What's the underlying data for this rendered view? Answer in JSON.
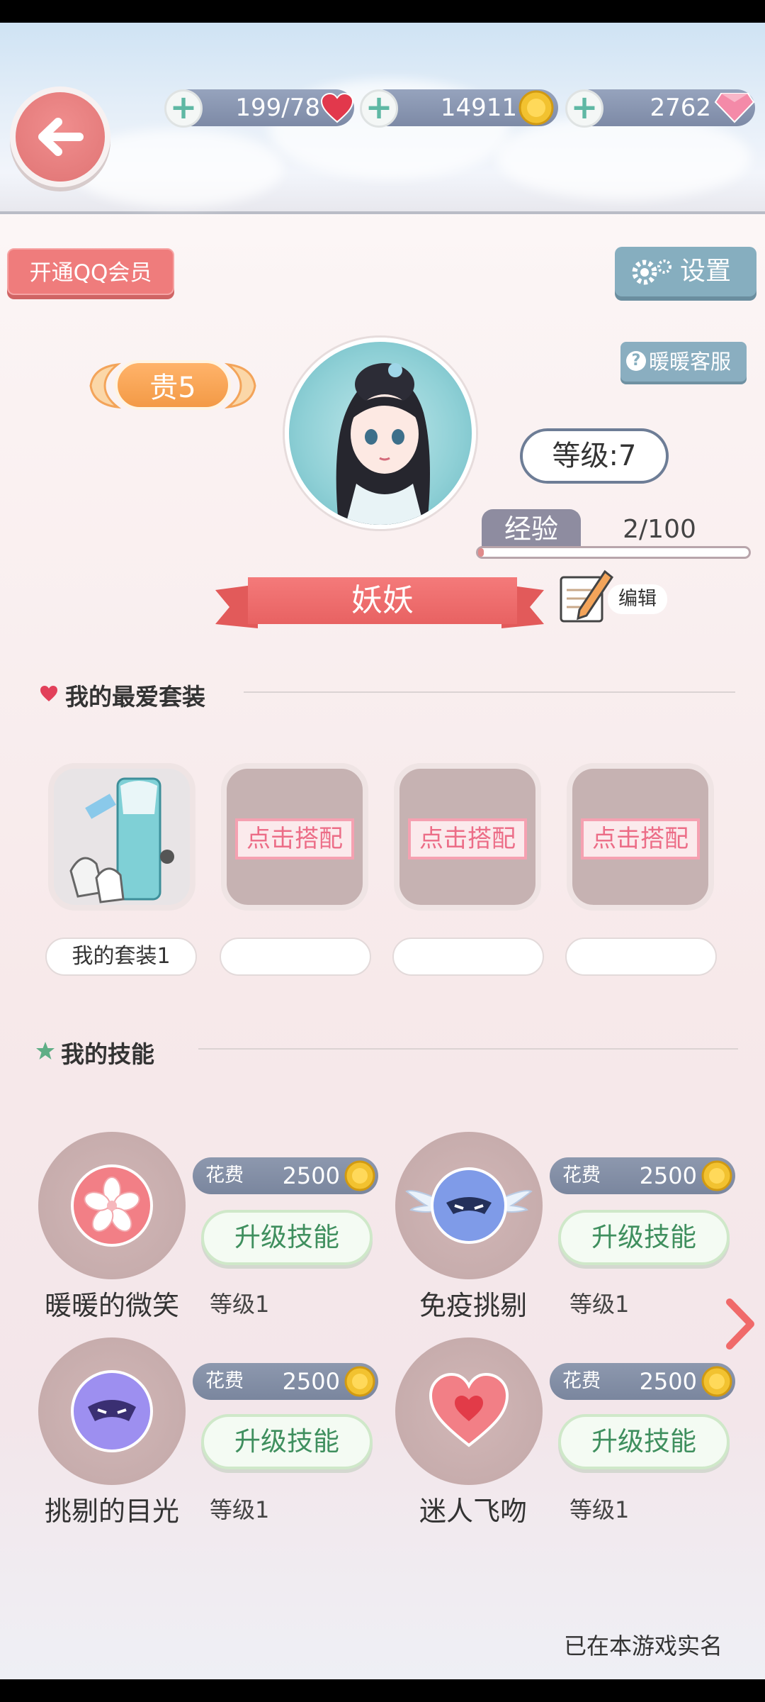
{
  "resources": {
    "stamina": "199/78",
    "gold": "14911",
    "diamonds": "2762"
  },
  "buttons": {
    "qq_vip": "开通QQ会员",
    "settings": "设置",
    "customer_service": "暖暖客服"
  },
  "profile": {
    "vip": "贵5",
    "level": "等级:7",
    "exp_label": "经验",
    "exp_value": "2/100",
    "exp_progress": 0.02,
    "nickname": "妖妖",
    "edit_label": "编辑"
  },
  "outfits": {
    "title": "我的最爱套装",
    "slots": [
      {
        "name": "我的套装1",
        "filled": true
      },
      {
        "action": "点击搭配",
        "name": ""
      },
      {
        "action": "点击搭配",
        "name": ""
      },
      {
        "action": "点击搭配",
        "name": ""
      }
    ]
  },
  "skills": {
    "title": "我的技能",
    "cost_label": "花费",
    "upgrade_label": "升级技能",
    "items": [
      {
        "name": "暖暖的微笑",
        "level": "等级1",
        "cost": "2500",
        "icon": "sakura-icon"
      },
      {
        "name": "免疫挑剔",
        "level": "等级1",
        "cost": "2500",
        "icon": "winged-mask-icon"
      },
      {
        "name": "挑剔的目光",
        "level": "等级1",
        "cost": "2500",
        "icon": "purple-mask-icon"
      },
      {
        "name": "迷人飞吻",
        "level": "等级1",
        "cost": "2500",
        "icon": "heart-icon"
      }
    ]
  },
  "footer": {
    "realname": "已在本游戏实名"
  },
  "colors": {
    "accent_pink": "#ef7c7c",
    "accent_blue": "#86aebf",
    "upgrade_green": "#3f8f5e"
  }
}
